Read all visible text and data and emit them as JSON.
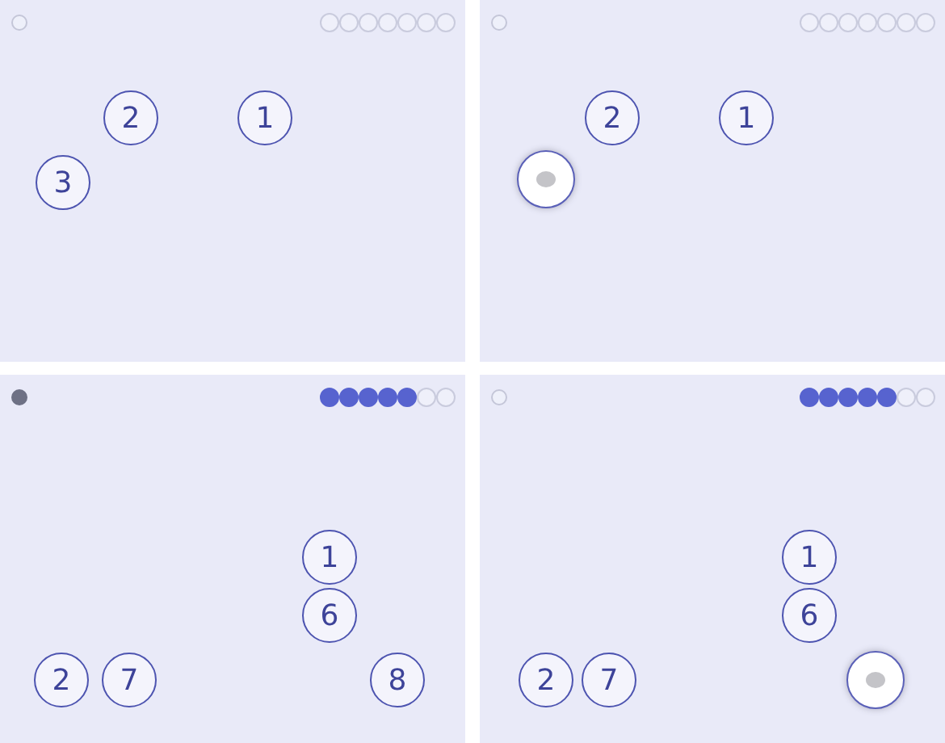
{
  "panels": [
    {
      "pause_pressed": false,
      "progress": [
        {
          "done": false
        },
        {
          "done": false
        },
        {
          "done": false
        },
        {
          "done": false
        },
        {
          "done": false
        },
        {
          "done": false
        },
        {
          "done": false
        }
      ],
      "targets": [
        {
          "kind": "number",
          "label": "2"
        },
        {
          "kind": "number",
          "label": "1"
        },
        {
          "kind": "number",
          "label": "3"
        }
      ]
    },
    {
      "pause_pressed": false,
      "progress": [
        {
          "done": false
        },
        {
          "done": false
        },
        {
          "done": false
        },
        {
          "done": false
        },
        {
          "done": false
        },
        {
          "done": false
        },
        {
          "done": false
        }
      ],
      "targets": [
        {
          "kind": "number",
          "label": "2"
        },
        {
          "kind": "number",
          "label": "1"
        },
        {
          "kind": "tapped"
        }
      ]
    },
    {
      "pause_pressed": true,
      "progress": [
        {
          "done": true
        },
        {
          "done": true
        },
        {
          "done": true
        },
        {
          "done": true
        },
        {
          "done": true
        },
        {
          "done": false
        },
        {
          "done": false
        }
      ],
      "targets": [
        {
          "kind": "number",
          "label": "1"
        },
        {
          "kind": "number",
          "label": "6"
        },
        {
          "kind": "number",
          "label": "2"
        },
        {
          "kind": "number",
          "label": "7"
        },
        {
          "kind": "number",
          "label": "8"
        }
      ]
    },
    {
      "pause_pressed": false,
      "progress": [
        {
          "done": true
        },
        {
          "done": true
        },
        {
          "done": true
        },
        {
          "done": true
        },
        {
          "done": true
        },
        {
          "done": false
        },
        {
          "done": false
        }
      ],
      "targets": [
        {
          "kind": "number",
          "label": "1"
        },
        {
          "kind": "number",
          "label": "6"
        },
        {
          "kind": "number",
          "label": "2"
        },
        {
          "kind": "number",
          "label": "7"
        },
        {
          "kind": "tapped"
        }
      ]
    }
  ]
}
